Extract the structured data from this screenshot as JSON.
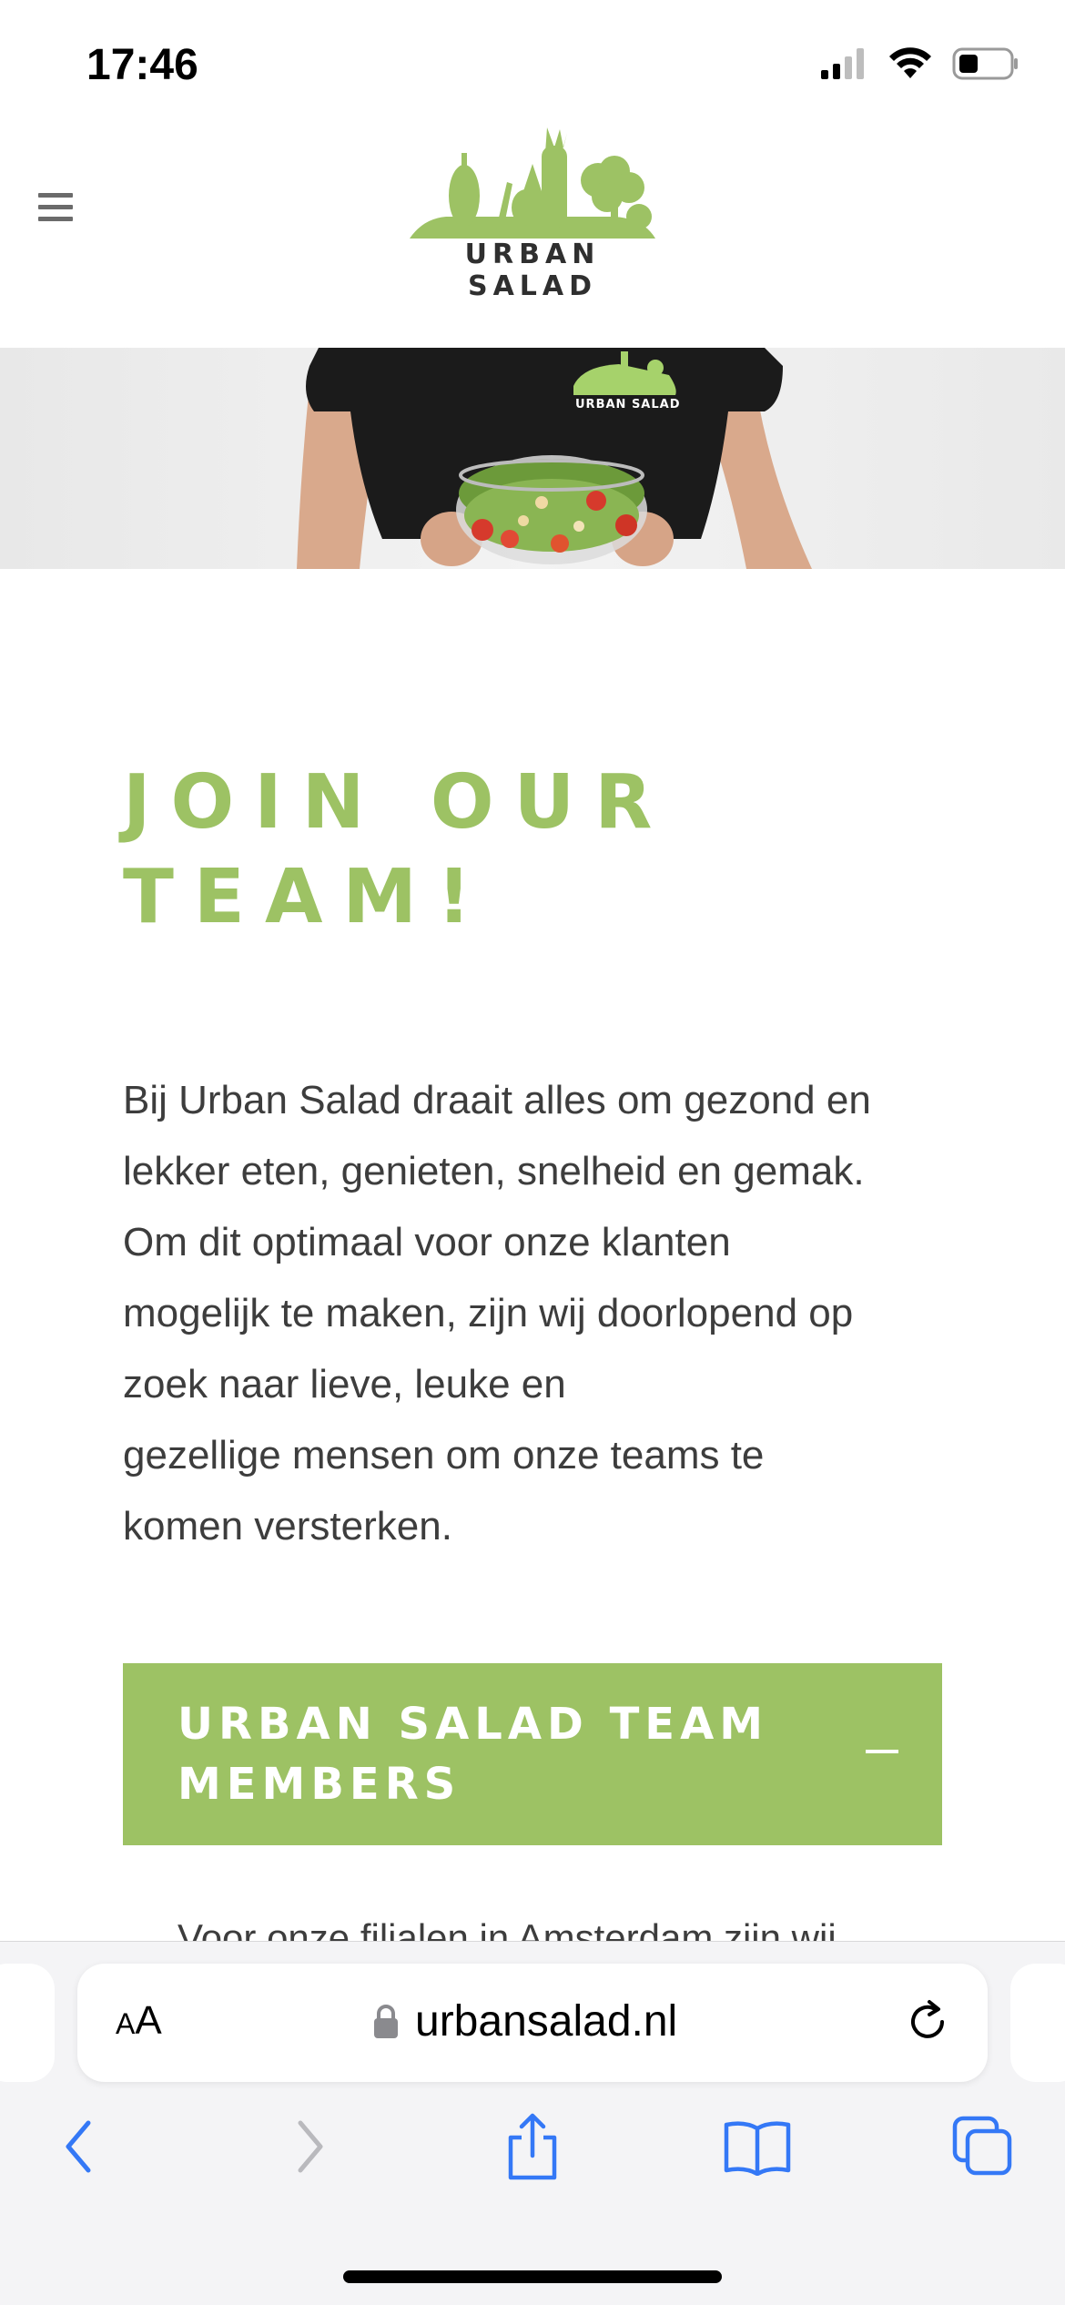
{
  "status_bar": {
    "time": "17:46"
  },
  "header": {
    "logo_text": "URBAN SALAD",
    "brand_color": "#9dc264"
  },
  "hero": {
    "shirt_logo_text": "URBAN SALAD"
  },
  "main": {
    "title_line1": "JOIN OUR",
    "title_line2": "TEAM!",
    "intro_lines": [
      "Bij Urban Salad draait alles om gezond en",
      "lekker eten, genieten, snelheid en gemak.",
      "Om dit optimaal voor onze klanten",
      "mogelijk te maken, zijn wij doorlopend op",
      "zoek naar lieve, leuke en",
      "gezellige mensen om onze teams te",
      "komen versterken."
    ],
    "accordion": {
      "title_line1": "URBAN SALAD TEAM",
      "title_line2": "MEMBERS",
      "toggle_symbol": "−"
    },
    "partial_text": "Voor onze filialen in Amsterdam zijn wij"
  },
  "safari": {
    "aa_label_small": "A",
    "aa_label_large": "A",
    "url": "urbansalad.nl"
  },
  "icons": {
    "signal": "cellular-signal-icon",
    "wifi": "wifi-icon",
    "battery": "battery-icon",
    "menu": "hamburger-menu-icon",
    "lock": "lock-icon",
    "reload": "reload-icon",
    "back": "chevron-left-icon",
    "forward": "chevron-right-icon",
    "share": "share-icon",
    "bookmarks": "book-icon",
    "tabs": "tabs-icon"
  }
}
